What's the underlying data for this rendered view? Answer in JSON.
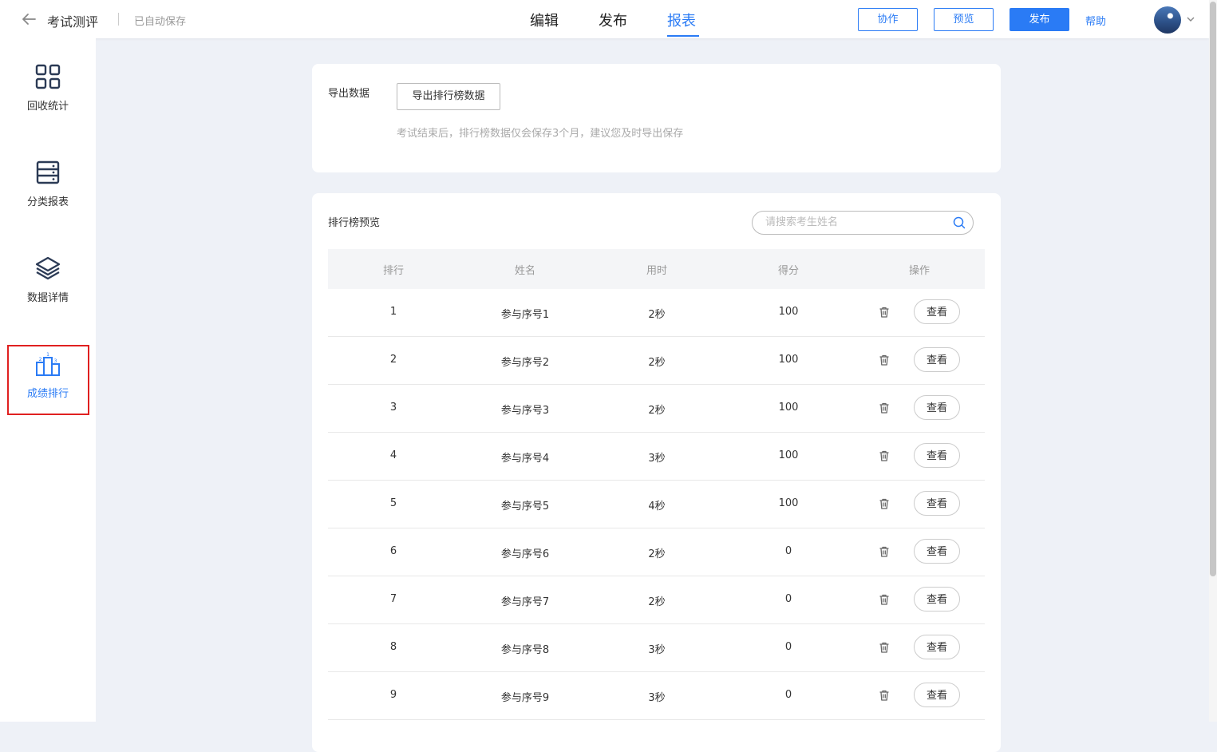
{
  "header": {
    "back_icon": "arrow-left-icon",
    "title": "考试测评",
    "autosave": "已自动保存",
    "tabs": [
      {
        "label": "编辑",
        "active": false
      },
      {
        "label": "发布",
        "active": false
      },
      {
        "label": "报表",
        "active": true
      }
    ],
    "collab_label": "协作",
    "preview_label": "预览",
    "publish_label": "发布",
    "help_label": "帮助"
  },
  "sidebar": {
    "items": [
      {
        "label": "回收统计",
        "icon": "grid-icon",
        "active": false
      },
      {
        "label": "分类报表",
        "icon": "server-icon",
        "active": false
      },
      {
        "label": "数据详情",
        "icon": "layers-icon",
        "active": false
      },
      {
        "label": "成绩排行",
        "icon": "podium-icon",
        "active": true
      }
    ]
  },
  "export": {
    "label": "导出数据",
    "button_label": "导出排行榜数据",
    "hint": "考试结束后，排行榜数据仅会保存3个月，建议您及时导出保存"
  },
  "ranking": {
    "title": "排行榜预览",
    "search_placeholder": "请搜索考生姓名",
    "columns": {
      "rank": "排行",
      "name": "姓名",
      "time": "用时",
      "score": "得分",
      "actions": "操作"
    },
    "view_label": "查看",
    "rows": [
      {
        "rank": "1",
        "name": "参与序号1",
        "time": "2秒",
        "score": "100"
      },
      {
        "rank": "2",
        "name": "参与序号2",
        "time": "2秒",
        "score": "100"
      },
      {
        "rank": "3",
        "name": "参与序号3",
        "time": "2秒",
        "score": "100"
      },
      {
        "rank": "4",
        "name": "参与序号4",
        "time": "3秒",
        "score": "100"
      },
      {
        "rank": "5",
        "name": "参与序号5",
        "time": "4秒",
        "score": "100"
      },
      {
        "rank": "6",
        "name": "参与序号6",
        "time": "2秒",
        "score": "0"
      },
      {
        "rank": "7",
        "name": "参与序号7",
        "time": "2秒",
        "score": "0"
      },
      {
        "rank": "8",
        "name": "参与序号8",
        "time": "3秒",
        "score": "0"
      },
      {
        "rank": "9",
        "name": "参与序号9",
        "time": "3秒",
        "score": "0"
      }
    ]
  },
  "colors": {
    "accent": "#2a7bf5",
    "highlight": "#e02020",
    "background": "#eef1f7"
  }
}
